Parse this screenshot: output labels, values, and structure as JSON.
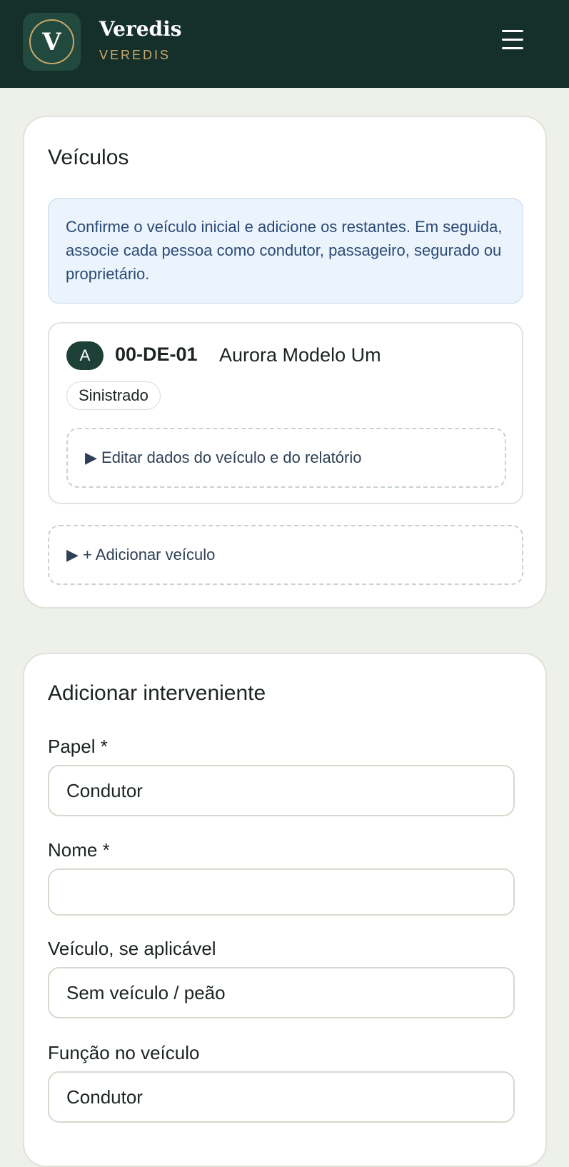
{
  "header": {
    "logo_letter": "V",
    "brand_title": "Veredis",
    "brand_subtitle": "VEREDIS",
    "menu_icon": "hamburger-menu-icon",
    "colors": {
      "bar": "#15302a",
      "accent": "#c9a869"
    }
  },
  "vehicles_card": {
    "title": "Veículos",
    "info_text": "Confirme o veículo inicial e adicione os restantes. Em seguida, associe cada pessoa como condutor, passageiro, segurado ou proprietário.",
    "vehicle": {
      "badge": "A",
      "plate": "00-DE-01",
      "model": "Aurora Modelo Um",
      "status": "Sinistrado",
      "edit_label": "▶ Editar dados do veículo e do relatório"
    },
    "add_vehicle_label": "▶ + Adicionar veículo"
  },
  "participant_card": {
    "title": "Adicionar interveniente",
    "fields": [
      {
        "label": "Papel *",
        "value": "Condutor"
      },
      {
        "label": "Nome *",
        "value": ""
      },
      {
        "label": "Veículo, se aplicável",
        "value": "Sem veículo / peão"
      },
      {
        "label": "Função no veículo",
        "value": "Condutor"
      }
    ]
  }
}
